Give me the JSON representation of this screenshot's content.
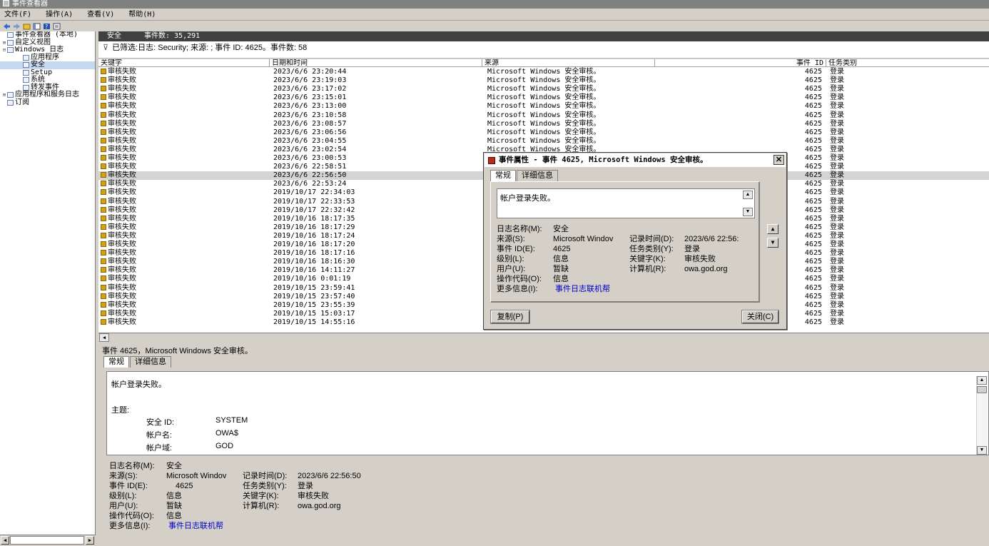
{
  "window": {
    "title": "事件查看器"
  },
  "menu": [
    "文件(F)",
    "操作(A)",
    "查看(V)",
    "帮助(H)"
  ],
  "tree": {
    "items": [
      {
        "label": "事件查看器 (本地)",
        "level": 0,
        "expander": ""
      },
      {
        "label": "自定义视图",
        "level": 0,
        "expander": "⊞"
      },
      {
        "label": "Windows 日志",
        "level": 0,
        "expander": "⊟"
      },
      {
        "label": "应用程序",
        "level": 1,
        "expander": ""
      },
      {
        "label": "安全",
        "level": 1,
        "expander": "",
        "selected": true
      },
      {
        "label": "Setup",
        "level": 1,
        "expander": ""
      },
      {
        "label": "系统",
        "level": 1,
        "expander": ""
      },
      {
        "label": "转发事件",
        "level": 1,
        "expander": ""
      },
      {
        "label": "应用程序和服务日志",
        "level": 0,
        "expander": "⊞"
      },
      {
        "label": "订阅",
        "level": 0,
        "expander": ""
      }
    ]
  },
  "log_header": {
    "name": "安全",
    "count_label": "事件数: 35,291"
  },
  "filter_text": "已筛选:日志: Security; 来源: ; 事件 ID: 4625。事件数: 58",
  "grid": {
    "columns": [
      "关键字",
      "日期和时间",
      "来源",
      "事件 ID",
      "任务类别"
    ],
    "rows": [
      [
        "审核失败",
        "2023/6/6 23:20:44",
        "Microsoft Windows 安全审核。",
        "4625",
        "登录"
      ],
      [
        "审核失败",
        "2023/6/6 23:19:03",
        "Microsoft Windows 安全审核。",
        "4625",
        "登录"
      ],
      [
        "审核失败",
        "2023/6/6 23:17:02",
        "Microsoft Windows 安全审核。",
        "4625",
        "登录"
      ],
      [
        "审核失败",
        "2023/6/6 23:15:01",
        "Microsoft Windows 安全审核。",
        "4625",
        "登录"
      ],
      [
        "审核失败",
        "2023/6/6 23:13:00",
        "Microsoft Windows 安全审核。",
        "4625",
        "登录"
      ],
      [
        "审核失败",
        "2023/6/6 23:10:58",
        "Microsoft Windows 安全审核。",
        "4625",
        "登录"
      ],
      [
        "审核失败",
        "2023/6/6 23:08:57",
        "Microsoft Windows 安全审核。",
        "4625",
        "登录"
      ],
      [
        "审核失败",
        "2023/6/6 23:06:56",
        "Microsoft Windows 安全审核。",
        "4625",
        "登录"
      ],
      [
        "审核失败",
        "2023/6/6 23:04:55",
        "Microsoft Windows 安全审核。",
        "4625",
        "登录"
      ],
      [
        "审核失败",
        "2023/6/6 23:02:54",
        "Microsoft Windows 安全审核。",
        "4625",
        "登录"
      ],
      [
        "审核失败",
        "2023/6/6 23:00:53",
        "",
        "4625",
        "登录"
      ],
      [
        "审核失败",
        "2023/6/6 22:58:51",
        "",
        "4625",
        "登录"
      ],
      [
        "审核失败",
        "2023/6/6 22:56:50",
        "",
        "4625",
        "登录"
      ],
      [
        "审核失败",
        "2023/6/6 22:53:24",
        "",
        "4625",
        "登录"
      ],
      [
        "审核失败",
        "2019/10/17 22:34:03",
        "",
        "4625",
        "登录"
      ],
      [
        "审核失败",
        "2019/10/17 22:33:53",
        "",
        "4625",
        "登录"
      ],
      [
        "审核失败",
        "2019/10/17 22:32:42",
        "",
        "4625",
        "登录"
      ],
      [
        "审核失败",
        "2019/10/16 18:17:35",
        "",
        "4625",
        "登录"
      ],
      [
        "审核失败",
        "2019/10/16 18:17:29",
        "",
        "4625",
        "登录"
      ],
      [
        "审核失败",
        "2019/10/16 18:17:24",
        "",
        "4625",
        "登录"
      ],
      [
        "审核失败",
        "2019/10/16 18:17:20",
        "",
        "4625",
        "登录"
      ],
      [
        "审核失败",
        "2019/10/16 18:17:16",
        "",
        "4625",
        "登录"
      ],
      [
        "审核失败",
        "2019/10/16 18:16:30",
        "",
        "4625",
        "登录"
      ],
      [
        "审核失败",
        "2019/10/16 14:11:27",
        "",
        "4625",
        "登录"
      ],
      [
        "审核失败",
        "2019/10/16 0:01:19",
        "",
        "4625",
        "登录"
      ],
      [
        "审核失败",
        "2019/10/15 23:59:41",
        "",
        "4625",
        "登录"
      ],
      [
        "审核失败",
        "2019/10/15 23:57:40",
        "",
        "4625",
        "登录"
      ],
      [
        "审核失败",
        "2019/10/15 23:55:39",
        "",
        "4625",
        "登录"
      ],
      [
        "审核失败",
        "2019/10/15 15:03:17",
        "",
        "4625",
        "登录"
      ],
      [
        "审核失败",
        "2019/10/15 14:55:16",
        "",
        "4625",
        "登录"
      ]
    ],
    "selected_index": 12
  },
  "detail": {
    "title": "事件 4625，Microsoft Windows 安全审核。",
    "tabs": [
      "常规",
      "详细信息"
    ],
    "message": "帐户登录失败。",
    "subject_label": "主题:",
    "subject": [
      {
        "k": "安全 ID:",
        "v": "SYSTEM"
      },
      {
        "k": "帐户名:",
        "v": "OWA$"
      },
      {
        "k": "帐户域:",
        "v": "GOD"
      }
    ],
    "props": {
      "log_name_k": "日志名称(M):",
      "log_name_v": "安全",
      "source_k": "来源(S):",
      "source_v": "Microsoft Windov",
      "logged_k": "记录时间(D):",
      "logged_v": "2023/6/6 22:56:50",
      "eventid_k": "事件 ID(E):",
      "eventid_v": "4625",
      "task_k": "任务类别(Y):",
      "task_v": "登录",
      "level_k": "级别(L):",
      "level_v": "信息",
      "keywords_k": "关键字(K):",
      "keywords_v": "审核失败",
      "user_k": "用户(U):",
      "user_v": "暂缺",
      "computer_k": "计算机(R):",
      "computer_v": "owa.god.org",
      "opcode_k": "操作代码(O):",
      "opcode_v": "信息",
      "more_k": "更多信息(I):",
      "more_v": "事件日志联机帮"
    }
  },
  "dialog": {
    "title": "事件属性 - 事件 4625, Microsoft Windows 安全审核。",
    "tabs": [
      "常规",
      "详细信息"
    ],
    "message": "帐户登录失败。",
    "props": {
      "log_name_k": "日志名称(M):",
      "log_name_v": "安全",
      "source_k": "来源(S):",
      "source_v": "Microsoft Windov",
      "logged_k": "记录时间(D):",
      "logged_v": "2023/6/6 22:56:",
      "eventid_k": "事件 ID(E):",
      "eventid_v": "4625",
      "task_k": "任务类别(Y):",
      "task_v": "登录",
      "level_k": "级别(L):",
      "level_v": "信息",
      "keywords_k": "关键字(K):",
      "keywords_v": "审核失败",
      "user_k": "用户(U):",
      "user_v": "暂缺",
      "computer_k": "计算机(R):",
      "computer_v": "owa.god.org",
      "opcode_k": "操作代码(O):",
      "opcode_v": "信息",
      "more_k": "更多信息(I):",
      "more_v": "事件日志联机帮"
    },
    "copy_label": "复制(P)",
    "close_label": "关闭(C)"
  },
  "colors": {
    "selected_row": "#d4d4d4",
    "link": "#0000cc",
    "log_bar": "#404040"
  }
}
